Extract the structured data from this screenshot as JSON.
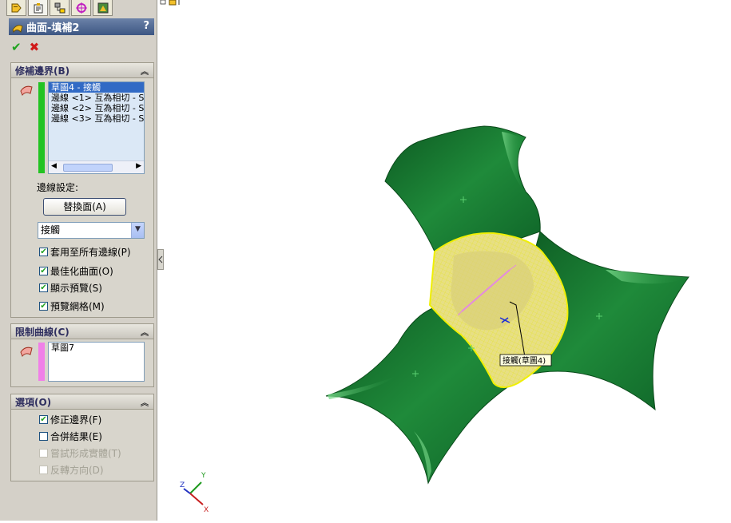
{
  "tabs": [
    {
      "name": "featuremanager-icon"
    },
    {
      "name": "propertymanager-icon"
    },
    {
      "name": "configurationmanager-icon"
    },
    {
      "name": "dimxpert-icon"
    },
    {
      "name": "display-manager-icon"
    }
  ],
  "header": {
    "title": "曲面-填補2",
    "help": "?"
  },
  "actions": {
    "ok": "✔",
    "cancel": "✖"
  },
  "patch_boundary": {
    "title": "修補邊界(B)",
    "items": [
      "草圖4 - 接觸",
      "邊線 <1> 互為相切 - S",
      "邊線 <2> 互為相切 - S",
      "邊線 <3> 互為相切 - S"
    ],
    "edge_settings_label": "邊線設定:",
    "alternate_face_label": "替換面(A)",
    "curvature_value": "接觸",
    "options": [
      {
        "label": "套用至所有邊線(P)",
        "checked": true
      },
      {
        "label": "最佳化曲面(O)",
        "checked": true
      },
      {
        "label": "顯示預覽(S)",
        "checked": true
      },
      {
        "label": "預覽網格(M)",
        "checked": true
      }
    ],
    "bar_color": "#22c322"
  },
  "constraint_curves": {
    "title": "限制曲線(C)",
    "items": [
      "草圖7"
    ],
    "bar_color": "#f080e8"
  },
  "options": {
    "title": "選項(O)",
    "items": [
      {
        "label": "修正邊界(F)",
        "checked": true,
        "enabled": true
      },
      {
        "label": "合併結果(E)",
        "checked": false,
        "enabled": true
      },
      {
        "label": "嘗試形成實體(T)",
        "checked": false,
        "enabled": false
      },
      {
        "label": "反轉方向(D)",
        "checked": false,
        "enabled": false
      }
    ]
  },
  "viewport": {
    "callout_label": "接觸(草圖4)",
    "triad_labels": {
      "x": "X",
      "y": "Y",
      "z": "Z"
    },
    "surface_color": "#1a7a30",
    "patch_color": "#e8e070"
  }
}
